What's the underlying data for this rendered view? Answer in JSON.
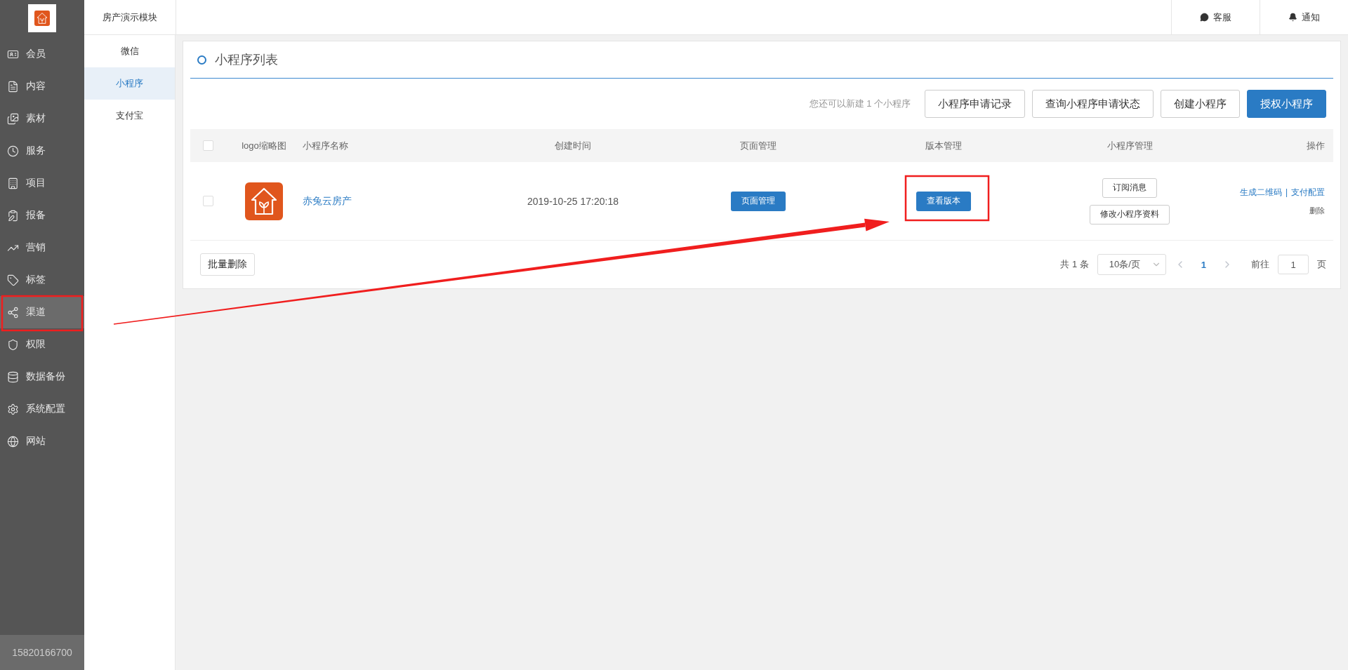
{
  "sidebar": {
    "items": [
      {
        "label": "会员",
        "selected": false
      },
      {
        "label": "内容",
        "selected": false
      },
      {
        "label": "素材",
        "selected": false
      },
      {
        "label": "服务",
        "selected": false
      },
      {
        "label": "项目",
        "selected": false
      },
      {
        "label": "报备",
        "selected": false
      },
      {
        "label": "营销",
        "selected": false
      },
      {
        "label": "标签",
        "selected": false
      },
      {
        "label": "渠道",
        "selected": true
      },
      {
        "label": "权限",
        "selected": false
      },
      {
        "label": "数据备份",
        "selected": false
      },
      {
        "label": "系统配置",
        "selected": false
      },
      {
        "label": "网站",
        "selected": false
      }
    ],
    "footer": "15820166700"
  },
  "submenu": {
    "title": "房产演示模块",
    "items": [
      {
        "label": "微信",
        "selected": false
      },
      {
        "label": "小程序",
        "selected": true
      },
      {
        "label": "支付宝",
        "selected": false
      }
    ]
  },
  "header": {
    "actions": [
      {
        "label": "客服"
      },
      {
        "label": "通知"
      }
    ]
  },
  "panel": {
    "title": "小程序列表",
    "hint": "您还可以新建 1 个小程序",
    "buttons": [
      {
        "label": "小程序申请记录",
        "primary": false
      },
      {
        "label": "查询小程序申请状态",
        "primary": false
      },
      {
        "label": "创建小程序",
        "primary": false
      },
      {
        "label": "授权小程序",
        "primary": true
      }
    ]
  },
  "table": {
    "all_checked": false,
    "columns": [
      "logo缩略图",
      "小程序名称",
      "创建时间",
      "页面管理",
      "版本管理",
      "小程序管理",
      "操作"
    ],
    "rows": [
      {
        "checked": false,
        "name": "赤兔云房产",
        "created": "2019-10-25 17:20:18",
        "page_action": "页面管理",
        "version_action": "查看版本",
        "manage_actions": [
          "订阅消息",
          "修改小程序资料"
        ],
        "links": [
          "生成二维码",
          "支付配置"
        ],
        "link_separator": "|",
        "delete": "删除"
      }
    ]
  },
  "bulk_delete": "批量删除",
  "pagination": {
    "total": "共 1 条",
    "page_size": "10条/页",
    "prev_disabled": true,
    "next_disabled": true,
    "pages": [
      {
        "label": "1",
        "selected": true
      }
    ],
    "goto_label": "前往",
    "goto_value": "1",
    "goto_suffix": "页"
  }
}
